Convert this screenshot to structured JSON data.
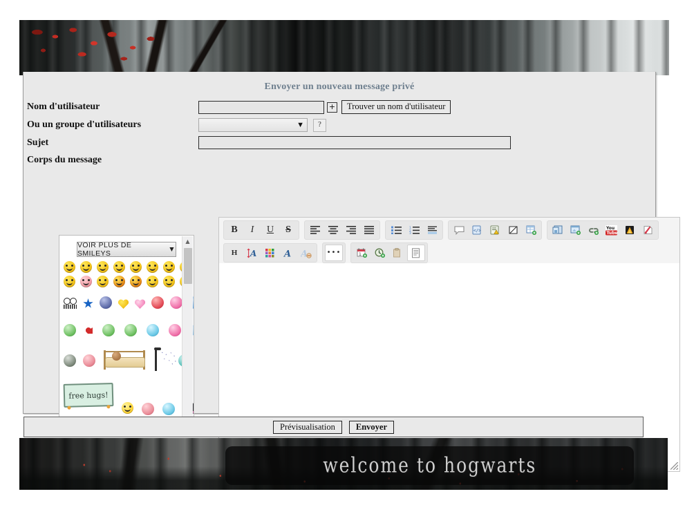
{
  "banners": {
    "top_alt": "dark-forest-red-leaves-banner",
    "bottom_alt": "dark-forest-banner",
    "welcome_text": "welcome to hogwarts"
  },
  "panel": {
    "title": "Envoyer un nouveau message privé"
  },
  "form": {
    "username": {
      "label": "Nom d'utilisateur",
      "value": "",
      "placeholder": "",
      "add_button": "+",
      "find_button": "Trouver un nom d'utilisateur"
    },
    "usergroup": {
      "label": "Ou un groupe d'utilisateurs",
      "selected": "",
      "help_button": "?"
    },
    "subject": {
      "label": "Sujet",
      "value": "",
      "placeholder": ""
    },
    "body": {
      "label": "Corps du message",
      "value": "",
      "placeholder": ""
    }
  },
  "smileys": {
    "more_button": "VOIR PLUS DE SMILEYS",
    "more_caret": "▼",
    "free_hugs_text": "free hugs!",
    "scroll_up": "▲",
    "scroll_down": "▼"
  },
  "toolbar": {
    "row1": [
      {
        "group": "text-style",
        "buttons": [
          {
            "name": "bold-button",
            "label": "B"
          },
          {
            "name": "italic-button",
            "label": "I"
          },
          {
            "name": "underline-button",
            "label": "U"
          },
          {
            "name": "strikethrough-button",
            "label": "S"
          }
        ]
      },
      {
        "group": "alignment",
        "buttons": [
          {
            "name": "align-left-button",
            "label": ""
          },
          {
            "name": "align-center-button",
            "label": ""
          },
          {
            "name": "align-right-button",
            "label": ""
          },
          {
            "name": "align-justify-button",
            "label": ""
          }
        ]
      },
      {
        "group": "lists",
        "buttons": [
          {
            "name": "unordered-list-button",
            "label": ""
          },
          {
            "name": "ordered-list-button",
            "label": ""
          },
          {
            "name": "indent-button",
            "label": ""
          }
        ]
      },
      {
        "group": "insert-blocks",
        "buttons": [
          {
            "name": "quote-button",
            "label": ""
          },
          {
            "name": "code-button",
            "label": ""
          },
          {
            "name": "spoiler-button",
            "label": ""
          },
          {
            "name": "hide-button",
            "label": ""
          },
          {
            "name": "table-button",
            "label": ""
          }
        ]
      },
      {
        "group": "media",
        "buttons": [
          {
            "name": "insert-image-button",
            "label": ""
          },
          {
            "name": "insert-picture-button",
            "label": ""
          },
          {
            "name": "insert-link-button",
            "label": ""
          },
          {
            "name": "youtube-button",
            "label": "You Tube"
          },
          {
            "name": "flash-button",
            "label": ""
          },
          {
            "name": "insert-script-button",
            "label": ""
          }
        ]
      }
    ],
    "row2": [
      {
        "group": "font",
        "buttons": [
          {
            "name": "heading-button",
            "label": "H"
          },
          {
            "name": "font-size-button",
            "label": "A"
          },
          {
            "name": "font-color-button",
            "label": ""
          },
          {
            "name": "font-face-button",
            "label": "A"
          },
          {
            "name": "remove-format-button",
            "label": "A"
          }
        ]
      },
      {
        "group": "more",
        "buttons": [
          {
            "name": "more-options-button",
            "label": "•••"
          }
        ]
      },
      {
        "group": "clipboard",
        "buttons": [
          {
            "name": "insert-date-button",
            "label": "1"
          },
          {
            "name": "insert-time-button",
            "label": ""
          },
          {
            "name": "paste-button",
            "label": ""
          },
          {
            "name": "page-button",
            "label": ""
          }
        ]
      }
    ]
  },
  "footer": {
    "preview_button": "Prévisualisation",
    "submit_button": "Envoyer"
  },
  "colors": {
    "title": "#6e7f8e",
    "panel_bg": "#e9e9e9",
    "toolbar_bg": "#f4f4f4",
    "accent_red": "#d32b2b",
    "accent_blue": "#1763c4"
  }
}
